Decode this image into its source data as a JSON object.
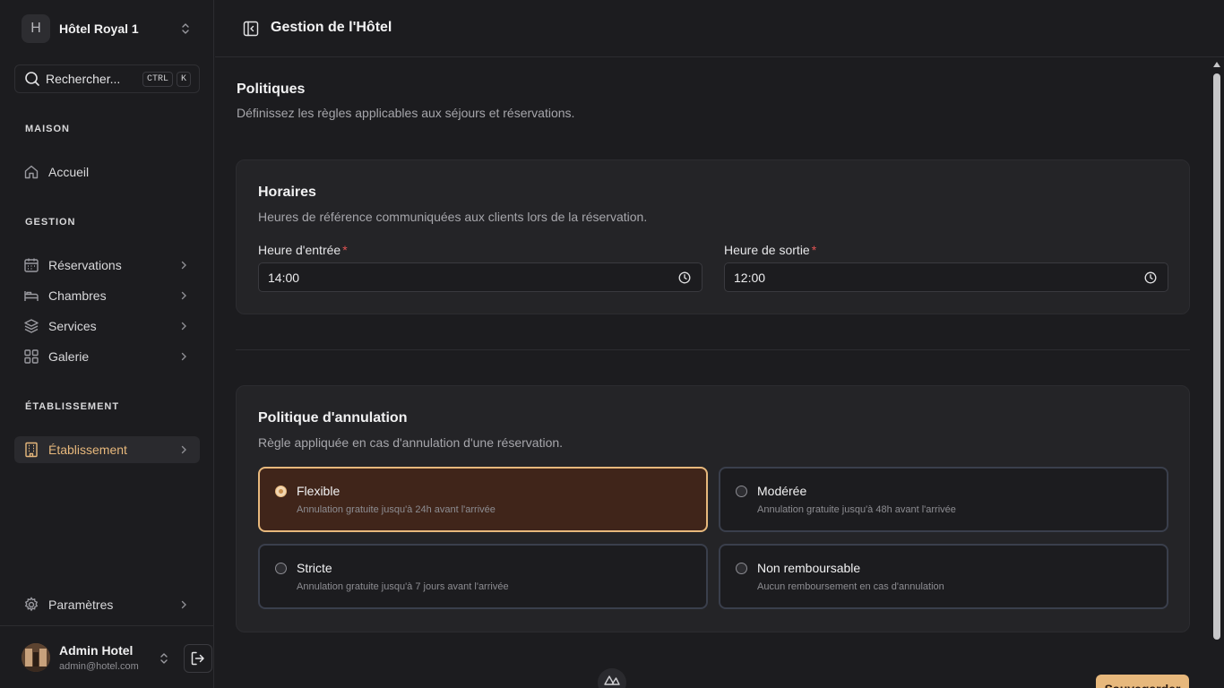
{
  "sidebar": {
    "hotel_initial": "H",
    "hotel_name": "Hôtel Royal 1",
    "search": {
      "label": "Rechercher...",
      "kbd1": "CTRL",
      "kbd2": "K"
    },
    "sections": {
      "home": "MAISON",
      "management": "GESTION",
      "establishment": "ÉTABLISSEMENT"
    },
    "items": {
      "home": "Accueil",
      "reservations": "Réservations",
      "rooms": "Chambres",
      "services": "Services",
      "gallery": "Galerie",
      "establishment": "Établissement",
      "settings": "Paramètres"
    },
    "user": {
      "name": "Admin Hotel",
      "email": "admin@hotel.com"
    }
  },
  "header": {
    "title": "Gestion de l'Hôtel"
  },
  "main": {
    "title": "Politiques",
    "subtitle": "Définissez les règles applicables aux séjours et réservations.",
    "hours": {
      "title": "Horaires",
      "subtitle": "Heures de référence communiquées aux clients lors de la réservation.",
      "checkin_label": "Heure d'entrée",
      "checkin_value": "14:00",
      "checkout_label": "Heure de sortie",
      "checkout_value": "12:00",
      "required_mark": "*"
    },
    "cancellation": {
      "title": "Politique d'annulation",
      "subtitle": "Règle appliquée en cas d'annulation d'une réservation.",
      "options": [
        {
          "title": "Flexible",
          "desc": "Annulation gratuite jusqu'à 24h avant l'arrivée",
          "selected": true
        },
        {
          "title": "Modérée",
          "desc": "Annulation gratuite jusqu'à 48h avant l'arrivée",
          "selected": false
        },
        {
          "title": "Stricte",
          "desc": "Annulation gratuite jusqu'à 7 jours avant l'arrivée",
          "selected": false
        },
        {
          "title": "Non remboursable",
          "desc": "Aucun remboursement en cas d'annulation",
          "selected": false
        }
      ]
    },
    "save_label": "Sauvegarder"
  },
  "colors": {
    "accent": "#e7b87c",
    "selected_bg": "#40251a",
    "background": "#1c1c1f",
    "card": "#242427"
  }
}
